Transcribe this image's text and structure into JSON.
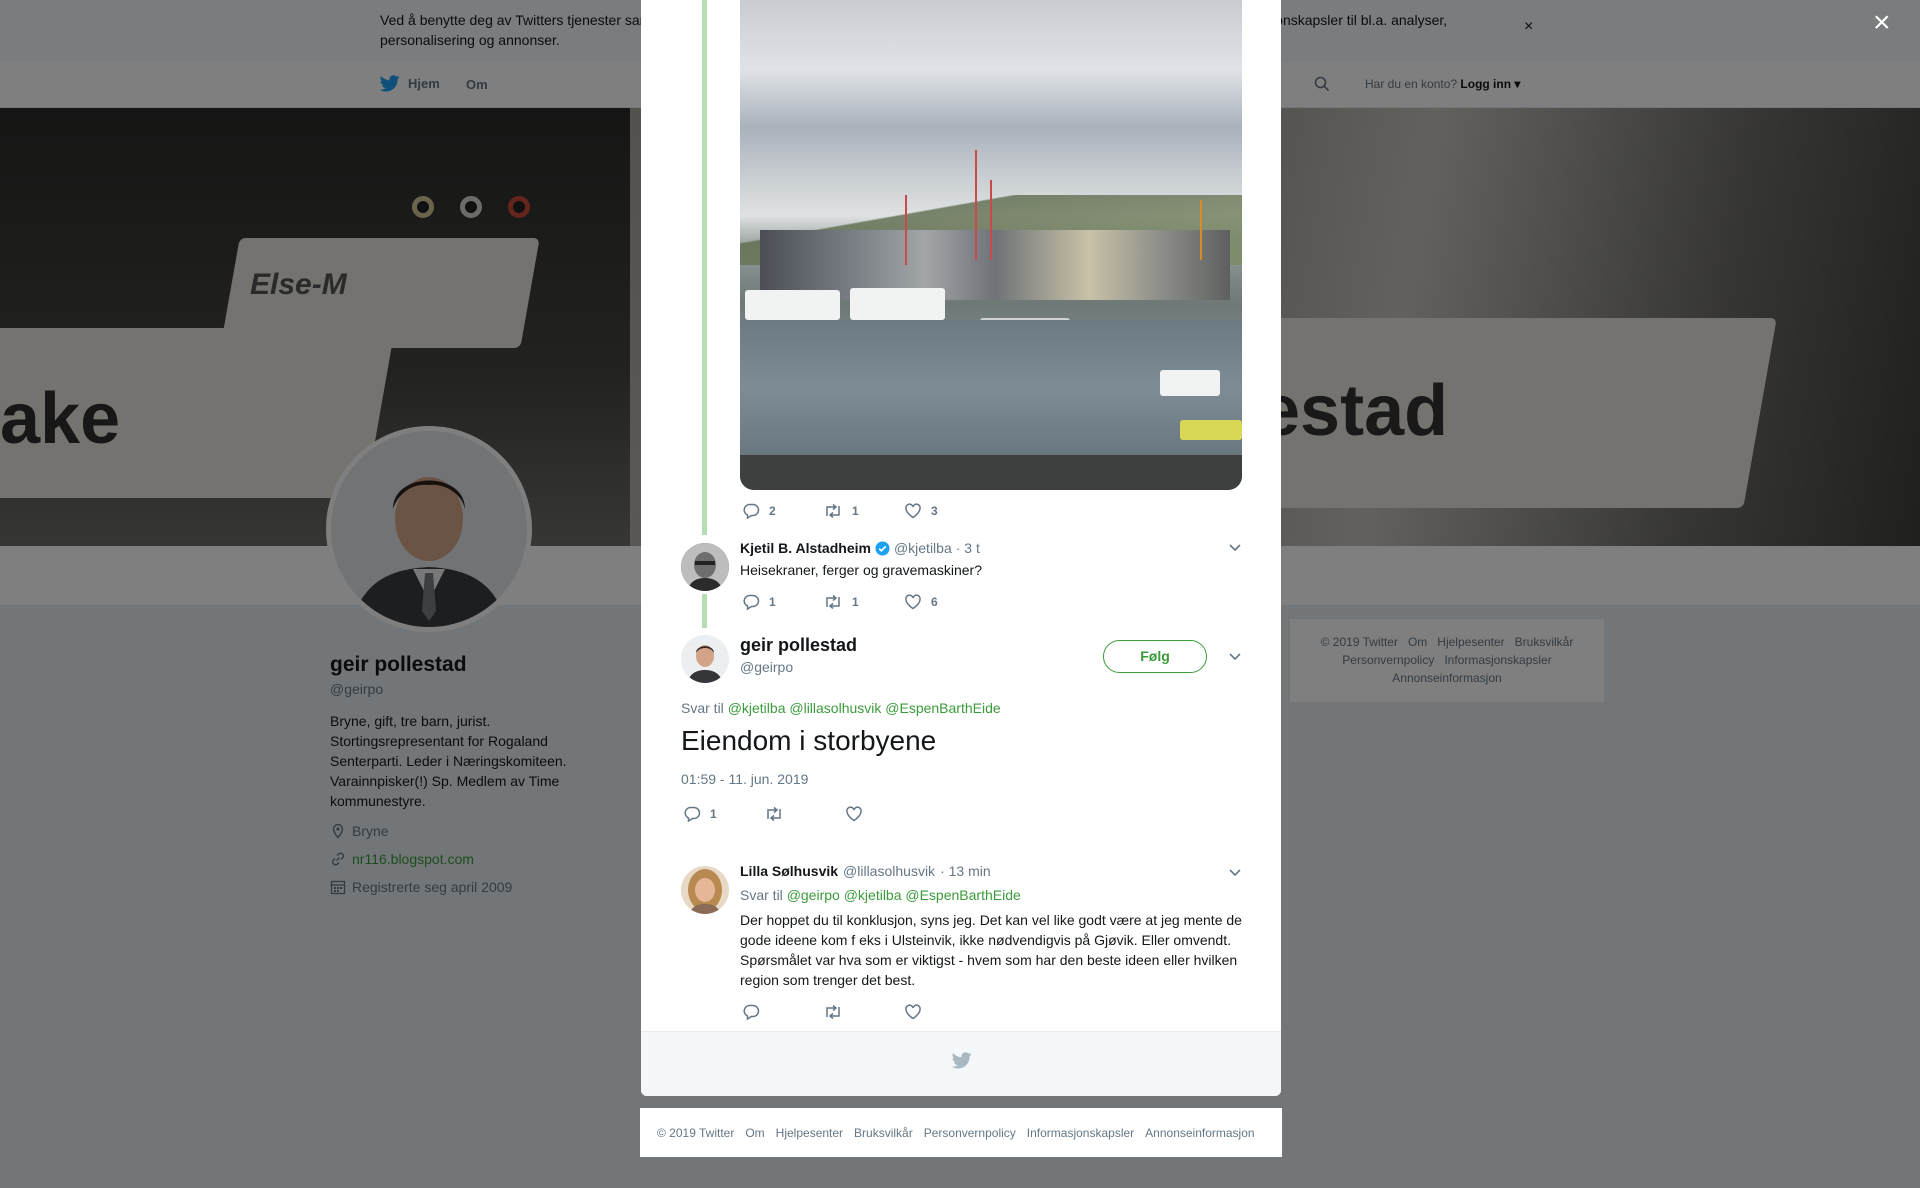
{
  "cookie": {
    "text": "Ved å benytte deg av Twitters tjenester samtykker du til vår bruk av informasjonskapsler. Vi og våre partnere opererer globalt og bruker informasjonskapsler til bl.a. analyser, personalisering og annonser.",
    "close": "×"
  },
  "nav": {
    "home": "Hjem",
    "about": "Om",
    "login_prompt": "Har du en konto?",
    "login": "Logg inn"
  },
  "banner": {
    "text_left": "Else-M",
    "text_mid": "ake",
    "text_right": "estad"
  },
  "profile": {
    "name": "geir pollestad",
    "handle": "@geirpo",
    "bio": "Bryne, gift, tre barn, jurist. Stortingsrepresentant for Rogaland Senterparti. Leder i Næringskomiteen. Varainnpisker(!) Sp. Medlem av Time kommunestyre.",
    "location": "Bryne",
    "website": "nr116.blogspot.com",
    "joined": "Registrerte seg april 2009"
  },
  "side_footer": {
    "items": [
      "© 2019 Twitter",
      "Om",
      "Hjelpesenter",
      "Bruksvilkår",
      "Personvernpolicy",
      "Informasjonskapsler",
      "Annonseinformasjon"
    ]
  },
  "overlay": {
    "close": "×"
  },
  "photo_tweet": {
    "replies": "2",
    "retweets": "1",
    "likes": "3"
  },
  "tweet_kjetil": {
    "name": "Kjetil B. Alstadheim",
    "handle": "@kjetilba",
    "time": "· 3 t",
    "text": "Heisekraner, ferger og gravemaskiner?",
    "replies": "1",
    "retweets": "1",
    "likes": "6"
  },
  "main_tweet": {
    "name": "geir pollestad",
    "handle": "@geirpo",
    "follow": "Følg",
    "reply_to_label": "Svar til",
    "reply_to": "@kjetilba @lillasolhusvik @EspenBarthEide",
    "text": "Eiendom i storbyene",
    "timestamp": "01:59 - 11. jun. 2019",
    "replies": "1"
  },
  "tweet_lilla": {
    "name": "Lilla Sølhusvik",
    "handle": "@lillasolhusvik",
    "time": "· 13 min",
    "reply_to_label": "Svar til",
    "reply_to": "@geirpo @kjetilba @EspenBarthEide",
    "text": "Der hoppet du til konklusjon, syns jeg. Det kan vel like godt være at jeg mente de gode ideene kom f eks i Ulsteinvik, ikke nødvendigvis på Gjøvik. Eller omvendt. Spørsmålet var hva som er viktigst - hvem som har den beste ideen eller hvilken region som trenger det best."
  },
  "bottom_footer": {
    "items": [
      "© 2019 Twitter",
      "Om",
      "Hjelpesenter",
      "Bruksvilkår",
      "Personvernpolicy",
      "Informasjonskapsler",
      "Annonseinformasjon"
    ]
  },
  "colors": {
    "accent": "#3b9b3b",
    "thread_line": "#b6ddb6",
    "verified": "#1da1f2",
    "muted": "#657786"
  },
  "icons": [
    "twitter-bird-icon",
    "search-icon",
    "location-icon",
    "link-icon",
    "calendar-icon",
    "reply-icon",
    "retweet-icon",
    "like-icon",
    "chevron-down-icon",
    "verified-badge-icon",
    "close-icon"
  ]
}
